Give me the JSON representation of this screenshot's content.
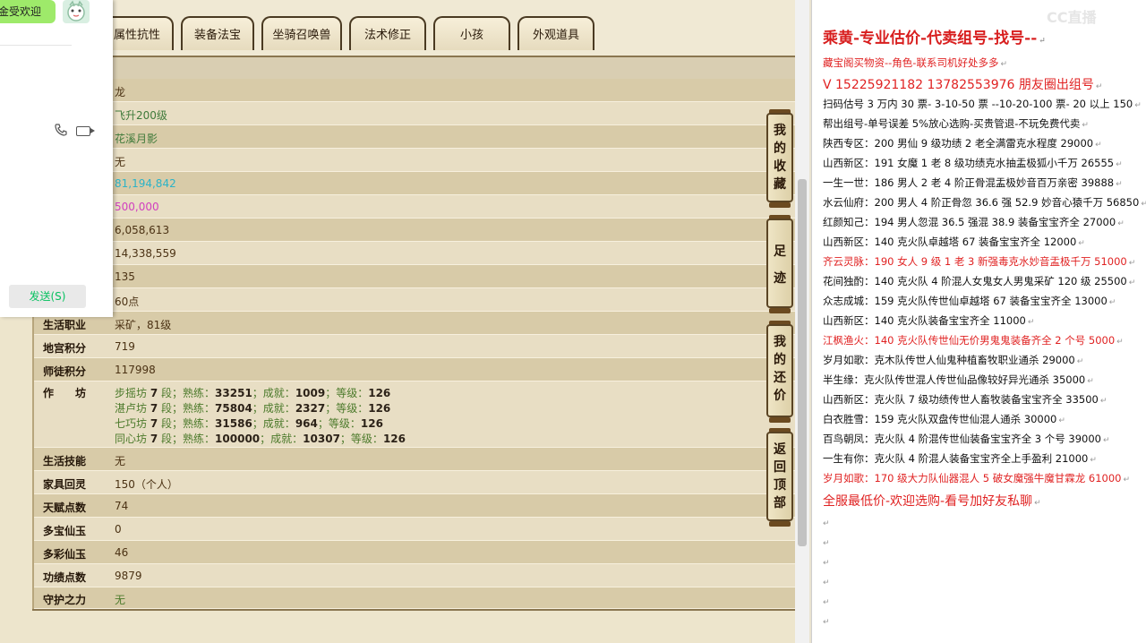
{
  "game": {
    "tabs": [
      "属性抗性",
      "装备法宝",
      "坐骑召唤兽",
      "法术修正",
      "小孩",
      "外观道具"
    ],
    "values_top": [
      "龙",
      "飞升200级",
      "花溪月影",
      "无",
      "81,194,842",
      "500,000",
      "6,058,613",
      "14,338,559",
      "135",
      "60点"
    ],
    "rows": [
      {
        "label": "生活职业",
        "value": "采矿，81级"
      },
      {
        "label": "地宫积分",
        "value": "719"
      },
      {
        "label": "师徒积分",
        "value": "117998"
      }
    ],
    "workshop": {
      "label": "作　　坊",
      "lines": [
        {
          "name": "步摇坊",
          "seg": "7",
          "seg_unit": "段；熟练：",
          "skill": "33251",
          "ach_label": "；成就：",
          "ach": "1009",
          "lvl_label": "；等级：",
          "lvl": "126"
        },
        {
          "name": "湛卢坊",
          "seg": "7",
          "seg_unit": "段；熟练：",
          "skill": "75804",
          "ach_label": "；成就：",
          "ach": "2327",
          "lvl_label": "；等级：",
          "lvl": "126"
        },
        {
          "name": "七巧坊",
          "seg": "7",
          "seg_unit": "段；熟练：",
          "skill": "31586",
          "ach_label": "；成就：",
          "ach": "964",
          "lvl_label": "；等级：",
          "lvl": "126"
        },
        {
          "name": "同心坊",
          "seg": "7",
          "seg_unit": "段；熟练：",
          "skill": "100000",
          "ach_label": "；成就：",
          "ach": "10307",
          "lvl_label": "；等级：",
          "lvl": "126"
        }
      ]
    },
    "rows_bottom": [
      {
        "label": "生活技能",
        "value": "无"
      },
      {
        "label": "家具回灵",
        "value": "150（个人）"
      },
      {
        "label": "天赋点数",
        "value": "74"
      },
      {
        "label": "多宝仙玉",
        "value": "0"
      },
      {
        "label": "多彩仙玉",
        "value": "46"
      },
      {
        "label": "功绩点数",
        "value": "9879"
      },
      {
        "label": "守护之力",
        "value": "无"
      }
    ],
    "side_buttons": [
      "我的收藏",
      "足迹",
      "我的还价",
      "返回顶部"
    ],
    "colors": {
      "value_cyan": "#2bb3c8",
      "value_magenta": "#d13fbf",
      "workshop_green": "#4c7a2b"
    }
  },
  "chat": {
    "bubble_text": "金受欢迎",
    "send_label": "发送(S)"
  },
  "doc": {
    "watermark": "CC直播",
    "title": "乘黄-专业估价-代卖组号-找号--",
    "lines": [
      {
        "text": "藏宝阁买物资--角色-联系司机好处多多",
        "red": true
      },
      {
        "text": "V 15225921182   13782553976 朋友圈出组号",
        "red": true,
        "big": true
      },
      {
        "text": "扫码估号 3 万内 30 票- 3-10-50 票  --10-20-100 票- 20 以上 150",
        "red": false
      },
      {
        "text": "帮出组号-单号误差 5%放心选购-买贵管退-不玩免费代卖",
        "red": false
      },
      {
        "text": "陕西专区：200 男仙 9 级功绩 2 老全满雷克水程度 29000",
        "red": false
      },
      {
        "text": "山西新区：191 女魔 1 老 8 级功绩克水抽盂极狐小千万 26555",
        "red": false
      },
      {
        "text": "一生一世：186 男人 2 老 4 阶正骨混盂极妙音百万亲密 39888",
        "red": false
      },
      {
        "text": "水云仙府：200 男人 4 阶正骨忽 36.6 强 52.9 妙音心猿千万 56850",
        "red": false
      },
      {
        "text": "红颜知己：194 男人忽混 36.5 强混 38.9 装备宝宝齐全 27000",
        "red": false
      },
      {
        "text": "山西新区：140 克火队卓越塔 67 装备宝宝齐全 12000",
        "red": false
      },
      {
        "text": "齐云灵脉：190 女人 9 级 1 老 3 新强毒克水妙音盂极千万 51000",
        "red": true
      },
      {
        "text": "花间独酌：140 克火队 4 阶混人女鬼女人男鬼采矿 120 级 25500",
        "red": false
      },
      {
        "text": "众志成城：159 克火队传世仙卓越塔 67 装备宝宝齐全 13000",
        "red": false
      },
      {
        "text": "山西新区：140 克火队装备宝宝齐全 11000",
        "red": false
      },
      {
        "text": "江枫渔火：140 克火队传世仙无价男鬼鬼装备齐全 2 个号 5000",
        "red": true
      },
      {
        "text": "岁月如歌：克木队传世人仙鬼种植畜牧职业通杀 29000",
        "red": false
      },
      {
        "text": "半生缘：克火队传世混人传世仙品像较好异光通杀 35000",
        "red": false
      },
      {
        "text": "山西新区：克火队 7 级功绩传世人畜牧装备宝宝齐全 33500",
        "red": false
      },
      {
        "text": "白衣胜雪：159 克火队双盘传世仙混人通杀 30000",
        "red": false
      },
      {
        "text": "百鸟朝凤：克火队 4 阶混传世仙装备宝宝齐全 3 个号 39000",
        "red": false
      },
      {
        "text": "一生有你：克火队 4 阶混人装备宝宝齐全上手盈利 21000",
        "red": false
      },
      {
        "text": "岁月如歌：170 级大力队仙器混人 5 破女魔强牛魔甘霖龙 61000",
        "red": true
      },
      {
        "text": "全服最低价-欢迎选购-看号加好友私聊",
        "red": true,
        "big": true
      }
    ],
    "para_mark": "↵"
  }
}
